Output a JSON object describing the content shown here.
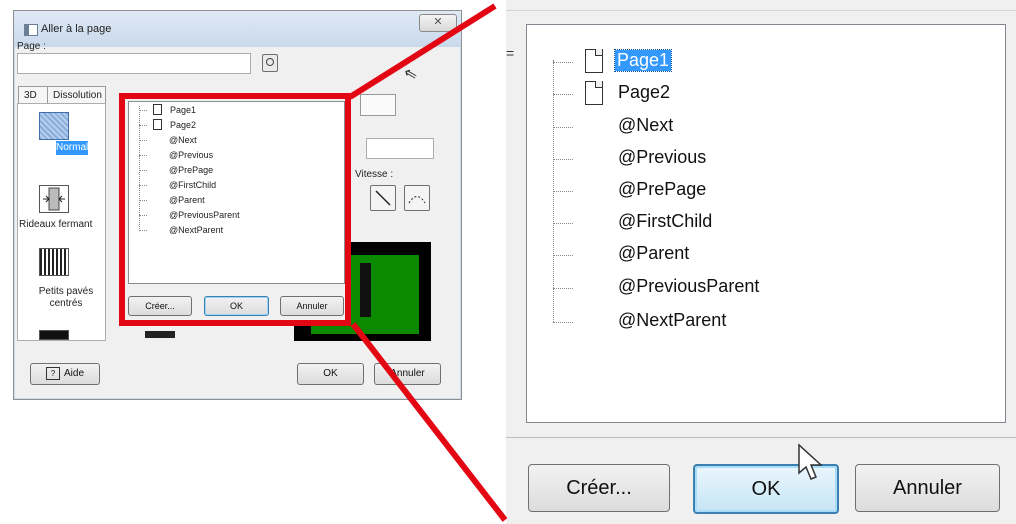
{
  "dialog": {
    "title": "Aller à la page",
    "close_label": "✕",
    "page_label": "Page :",
    "tabs": [
      "3D",
      "Dissolution"
    ],
    "effects": [
      "Normal",
      "Rideaux fermant",
      "Petits pavés centrés"
    ],
    "speed_label": "Vitesse :",
    "buttons": {
      "help": "Aide",
      "ok": "OK",
      "cancel": "Annuler"
    }
  },
  "popup": {
    "tree_items": [
      "Page1",
      "Page2",
      "@Next",
      "@Previous",
      "@PrePage",
      "@FirstChild",
      "@Parent",
      "@PreviousParent",
      "@NextParent"
    ],
    "buttons": {
      "create": "Créer...",
      "ok": "OK",
      "cancel": "Annuler"
    }
  },
  "zoom": {
    "tree_items": [
      "Page1",
      "Page2",
      "@Next",
      "@Previous",
      "@PrePage",
      "@FirstChild",
      "@Parent",
      "@PreviousParent",
      "@NextParent"
    ],
    "selected_index": 0,
    "buttons": {
      "create": "Créer...",
      "ok": "OK",
      "cancel": "Annuler"
    }
  },
  "colors": {
    "highlight": "#e30613",
    "selection": "#3399ff",
    "preview_green": "#0b8a00"
  }
}
